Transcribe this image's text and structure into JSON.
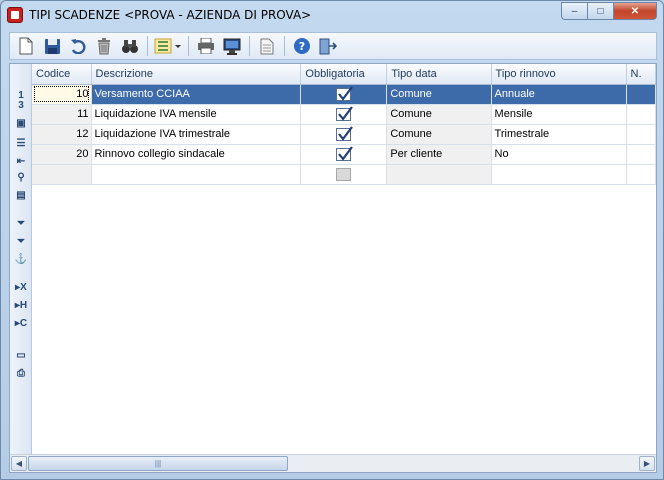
{
  "window": {
    "title": "TIPI SCADENZE <PROVA - AZIENDA DI PROVA>",
    "minimize": "–",
    "maximize": "□",
    "close": "✕"
  },
  "toolbar": [
    {
      "icon": "new-document-icon"
    },
    {
      "icon": "save-icon"
    },
    {
      "icon": "undo-icon"
    },
    {
      "icon": "delete-icon"
    },
    {
      "icon": "binoculars-search-icon"
    },
    {
      "icon": "list-menu-icon"
    },
    {
      "icon": "print-icon"
    },
    {
      "icon": "monitor-preview-icon"
    },
    {
      "icon": "page-icon"
    },
    {
      "icon": "help-icon"
    },
    {
      "icon": "exit-icon"
    }
  ],
  "rowbar": {
    "counter_top": "1",
    "counter_bottom": "3"
  },
  "grid": {
    "columns": [
      "Codice",
      "Descrizione",
      "Obbligatoria",
      "Tipo data",
      "Tipo rinnovo",
      "N."
    ],
    "rows": [
      {
        "codice": "10",
        "descrizione": "Versamento CCIAA",
        "obbligatoria": true,
        "tipo_data": "Comune",
        "tipo_rinnovo": "Annuale"
      },
      {
        "codice": "11",
        "descrizione": "Liquidazione IVA mensile",
        "obbligatoria": true,
        "tipo_data": "Comune",
        "tipo_rinnovo": "Mensile"
      },
      {
        "codice": "12",
        "descrizione": "Liquidazione IVA trimestrale",
        "obbligatoria": true,
        "tipo_data": "Comune",
        "tipo_rinnovo": "Trimestrale"
      },
      {
        "codice": "20",
        "descrizione": "Rinnovo collegio sindacale",
        "obbligatoria": true,
        "tipo_data": "Per cliente",
        "tipo_rinnovo": "No"
      }
    ]
  },
  "colors": {
    "selection": "#3d6aa8",
    "window_frame": "#b9d1ea"
  }
}
